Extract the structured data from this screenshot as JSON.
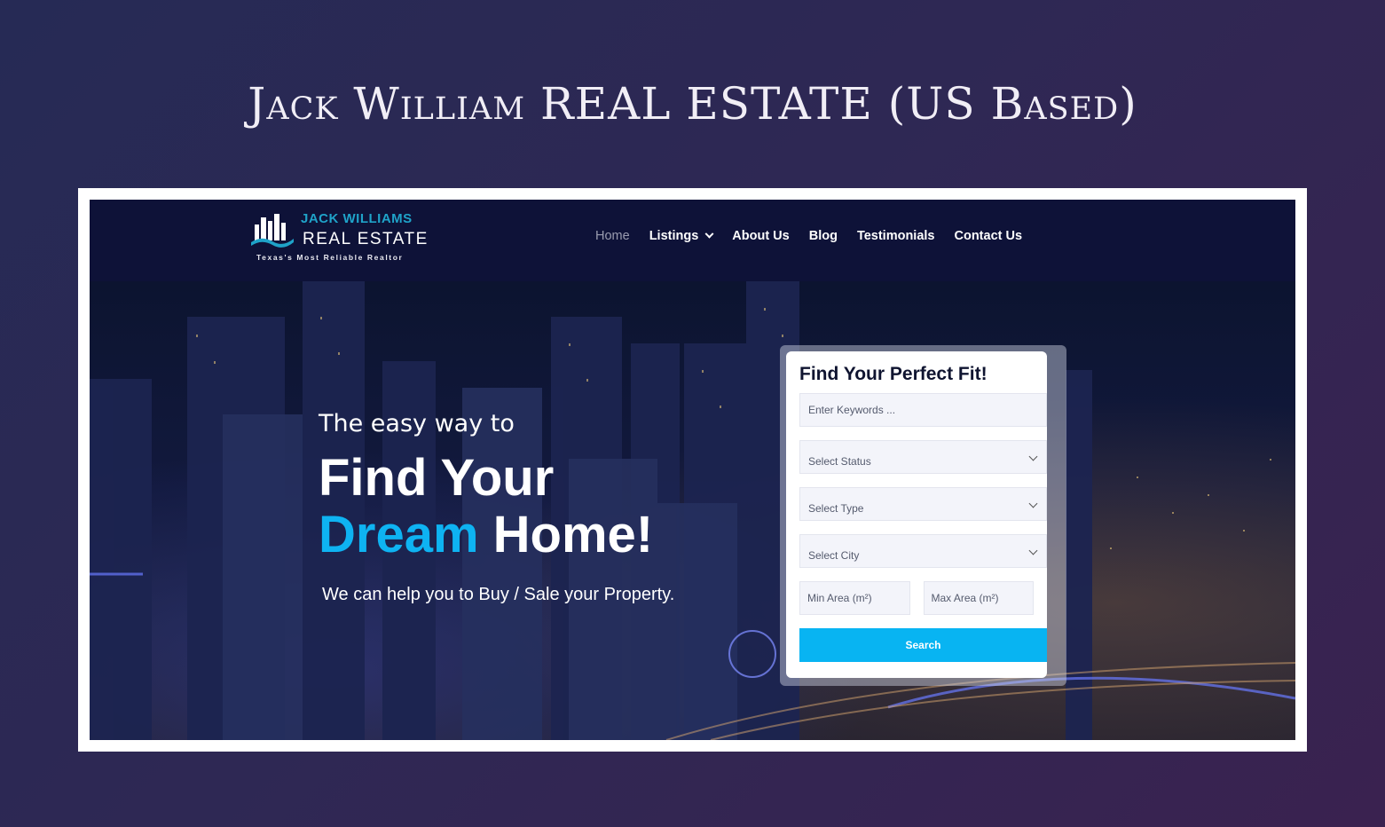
{
  "showcase": {
    "title": "Jack William REAL ESTATE (US Based)"
  },
  "logo": {
    "line1": "JACK WILLIAMS",
    "line2": "REAL ESTATE",
    "tagline": "Texas's Most Reliable Realtor"
  },
  "nav": {
    "items": [
      {
        "label": "Home",
        "active": true
      },
      {
        "label": "Listings",
        "has_dropdown": true
      },
      {
        "label": "About Us"
      },
      {
        "label": "Blog"
      },
      {
        "label": "Testimonials"
      },
      {
        "label": "Contact Us"
      }
    ]
  },
  "hero": {
    "tagline": "The easy way to",
    "headline_line1": "Find Your",
    "headline_accent": "Dream",
    "headline_rest": " Home!",
    "subline": "We can help you to Buy / Sale your Property."
  },
  "search": {
    "title": "Find Your Perfect Fit!",
    "keywords_placeholder": "Enter Keywords ...",
    "status_label": "Select Status",
    "type_label": "Select Type",
    "city_label": "Select City",
    "min_area_placeholder": "Min Area (m²)",
    "max_area_placeholder": "Max Area (m²)",
    "button_label": "Search"
  },
  "colors": {
    "accent": "#0eb3f2",
    "nav_bg": "#0e1238",
    "button": "#08b4f2"
  }
}
